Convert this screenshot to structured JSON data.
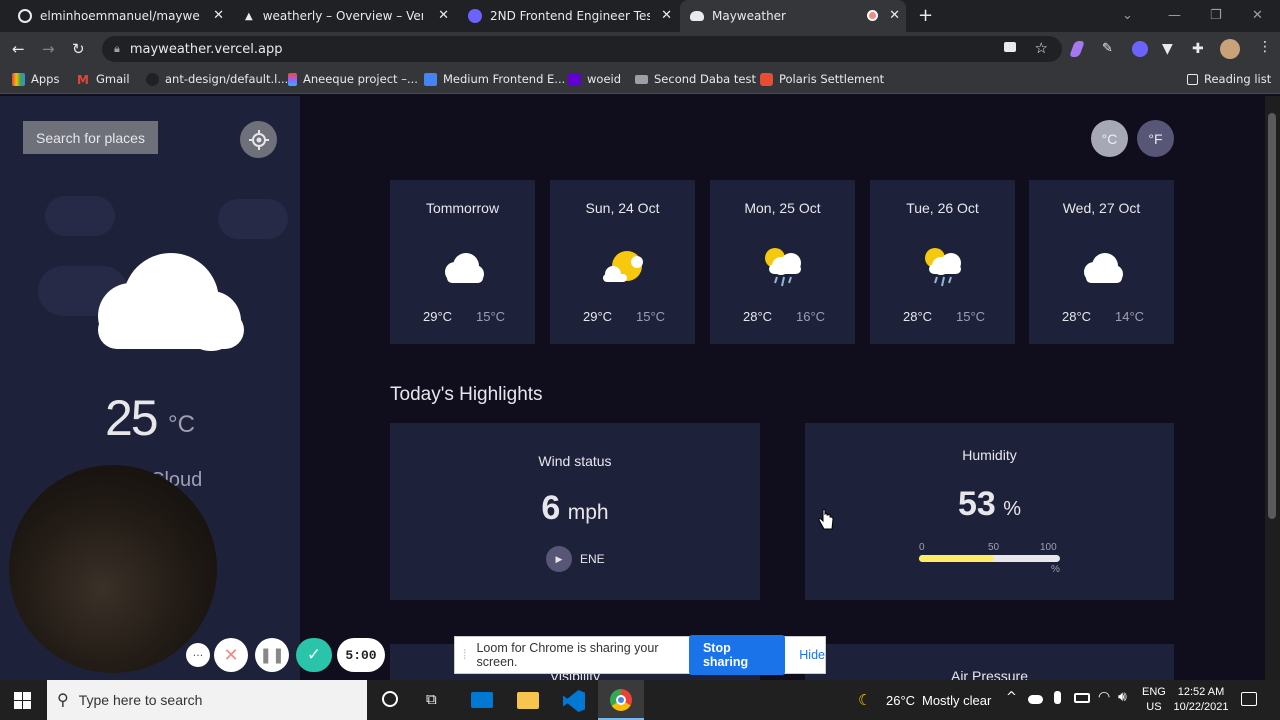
{
  "tabs": [
    {
      "title": "elminhoemmanuel/mayweathe",
      "active": false,
      "color": "#e8eaed"
    },
    {
      "title": "weatherly – Overview – Vercel",
      "active": false,
      "color": "#ffffff"
    },
    {
      "title": "2ND Frontend Engineer Test Dep",
      "active": false,
      "color": "#6c63ff"
    },
    {
      "title": "Mayweather",
      "active": true,
      "color": "#ffffff"
    }
  ],
  "address": "mayweather.vercel.app",
  "bookmarks": [
    {
      "label": "Apps",
      "icon": "apps-grid-icon"
    },
    {
      "label": "Gmail",
      "icon": "gmail-icon"
    },
    {
      "label": "ant-design/default.l...",
      "icon": "github-icon"
    },
    {
      "label": "Aneeque project –...",
      "icon": "figma-icon"
    },
    {
      "label": "Medium Frontend E...",
      "icon": "docs-icon"
    },
    {
      "label": "woeid",
      "icon": "yahoo-icon"
    },
    {
      "label": "Second Daba test",
      "icon": "drive-icon"
    },
    {
      "label": "Polaris Settlement",
      "icon": "polaris-icon"
    }
  ],
  "reading_list": "Reading list",
  "sidebar": {
    "search_label": "Search for places",
    "temp": "25",
    "unit": "°C",
    "description": "Cloud"
  },
  "units": {
    "celsius": "°C",
    "fahrenheit": "°F"
  },
  "forecast": [
    {
      "day": "Tommorrow",
      "icon": "cloud-icon",
      "high": "29°C",
      "low": "15°C"
    },
    {
      "day": "Sun, 24 Oct",
      "icon": "sun-cloud-icon",
      "high": "29°C",
      "low": "15°C"
    },
    {
      "day": "Mon, 25 Oct",
      "icon": "sun-rain-icon",
      "high": "28°C",
      "low": "16°C"
    },
    {
      "day": "Tue, 26 Oct",
      "icon": "sun-rain-icon",
      "high": "28°C",
      "low": "15°C"
    },
    {
      "day": "Wed, 27 Oct",
      "icon": "cloud-icon",
      "high": "28°C",
      "low": "14°C"
    }
  ],
  "highlights": {
    "title": "Today's Highlights",
    "wind": {
      "label": "Wind status",
      "value": "6",
      "unit": "mph",
      "direction": "ENE"
    },
    "humidity": {
      "label": "Humidity",
      "value": "53",
      "unit": "%",
      "scale": [
        "0",
        "50",
        "100"
      ],
      "scale_unit": "%",
      "level_percent": 53
    },
    "visibility": {
      "label": "Visibility"
    },
    "pressure": {
      "label": "Air Pressure"
    }
  },
  "recording": {
    "timer": "5:00"
  },
  "loom": {
    "message": "Loom for Chrome is sharing your screen.",
    "stop": "Stop sharing",
    "hide": "Hide"
  },
  "taskbar": {
    "search_placeholder": "Type here to search",
    "weather_temp": "26°C",
    "weather_text": "Mostly clear",
    "lang": "ENG",
    "region": "US",
    "time": "12:52 AM",
    "date": "10/22/2021"
  }
}
